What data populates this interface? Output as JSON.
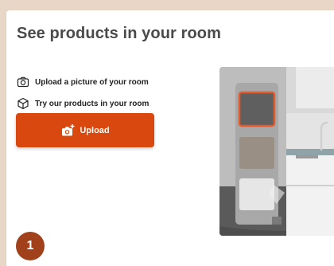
{
  "page": {
    "title": "See products in your room"
  },
  "steps": [
    {
      "label": "Upload a picture of your room",
      "icon": "camera-icon"
    },
    {
      "label": "Try our products in your room",
      "icon": "cube-icon"
    }
  ],
  "upload": {
    "label": "Upload",
    "icon": "add-photo-icon"
  },
  "badge": {
    "text": "1"
  },
  "colors": {
    "accent": "#d9480f",
    "badge": "#a0411c",
    "background": "#e8d6c6",
    "title": "#4a4a4a",
    "highlight_border": "#e25b2c"
  }
}
